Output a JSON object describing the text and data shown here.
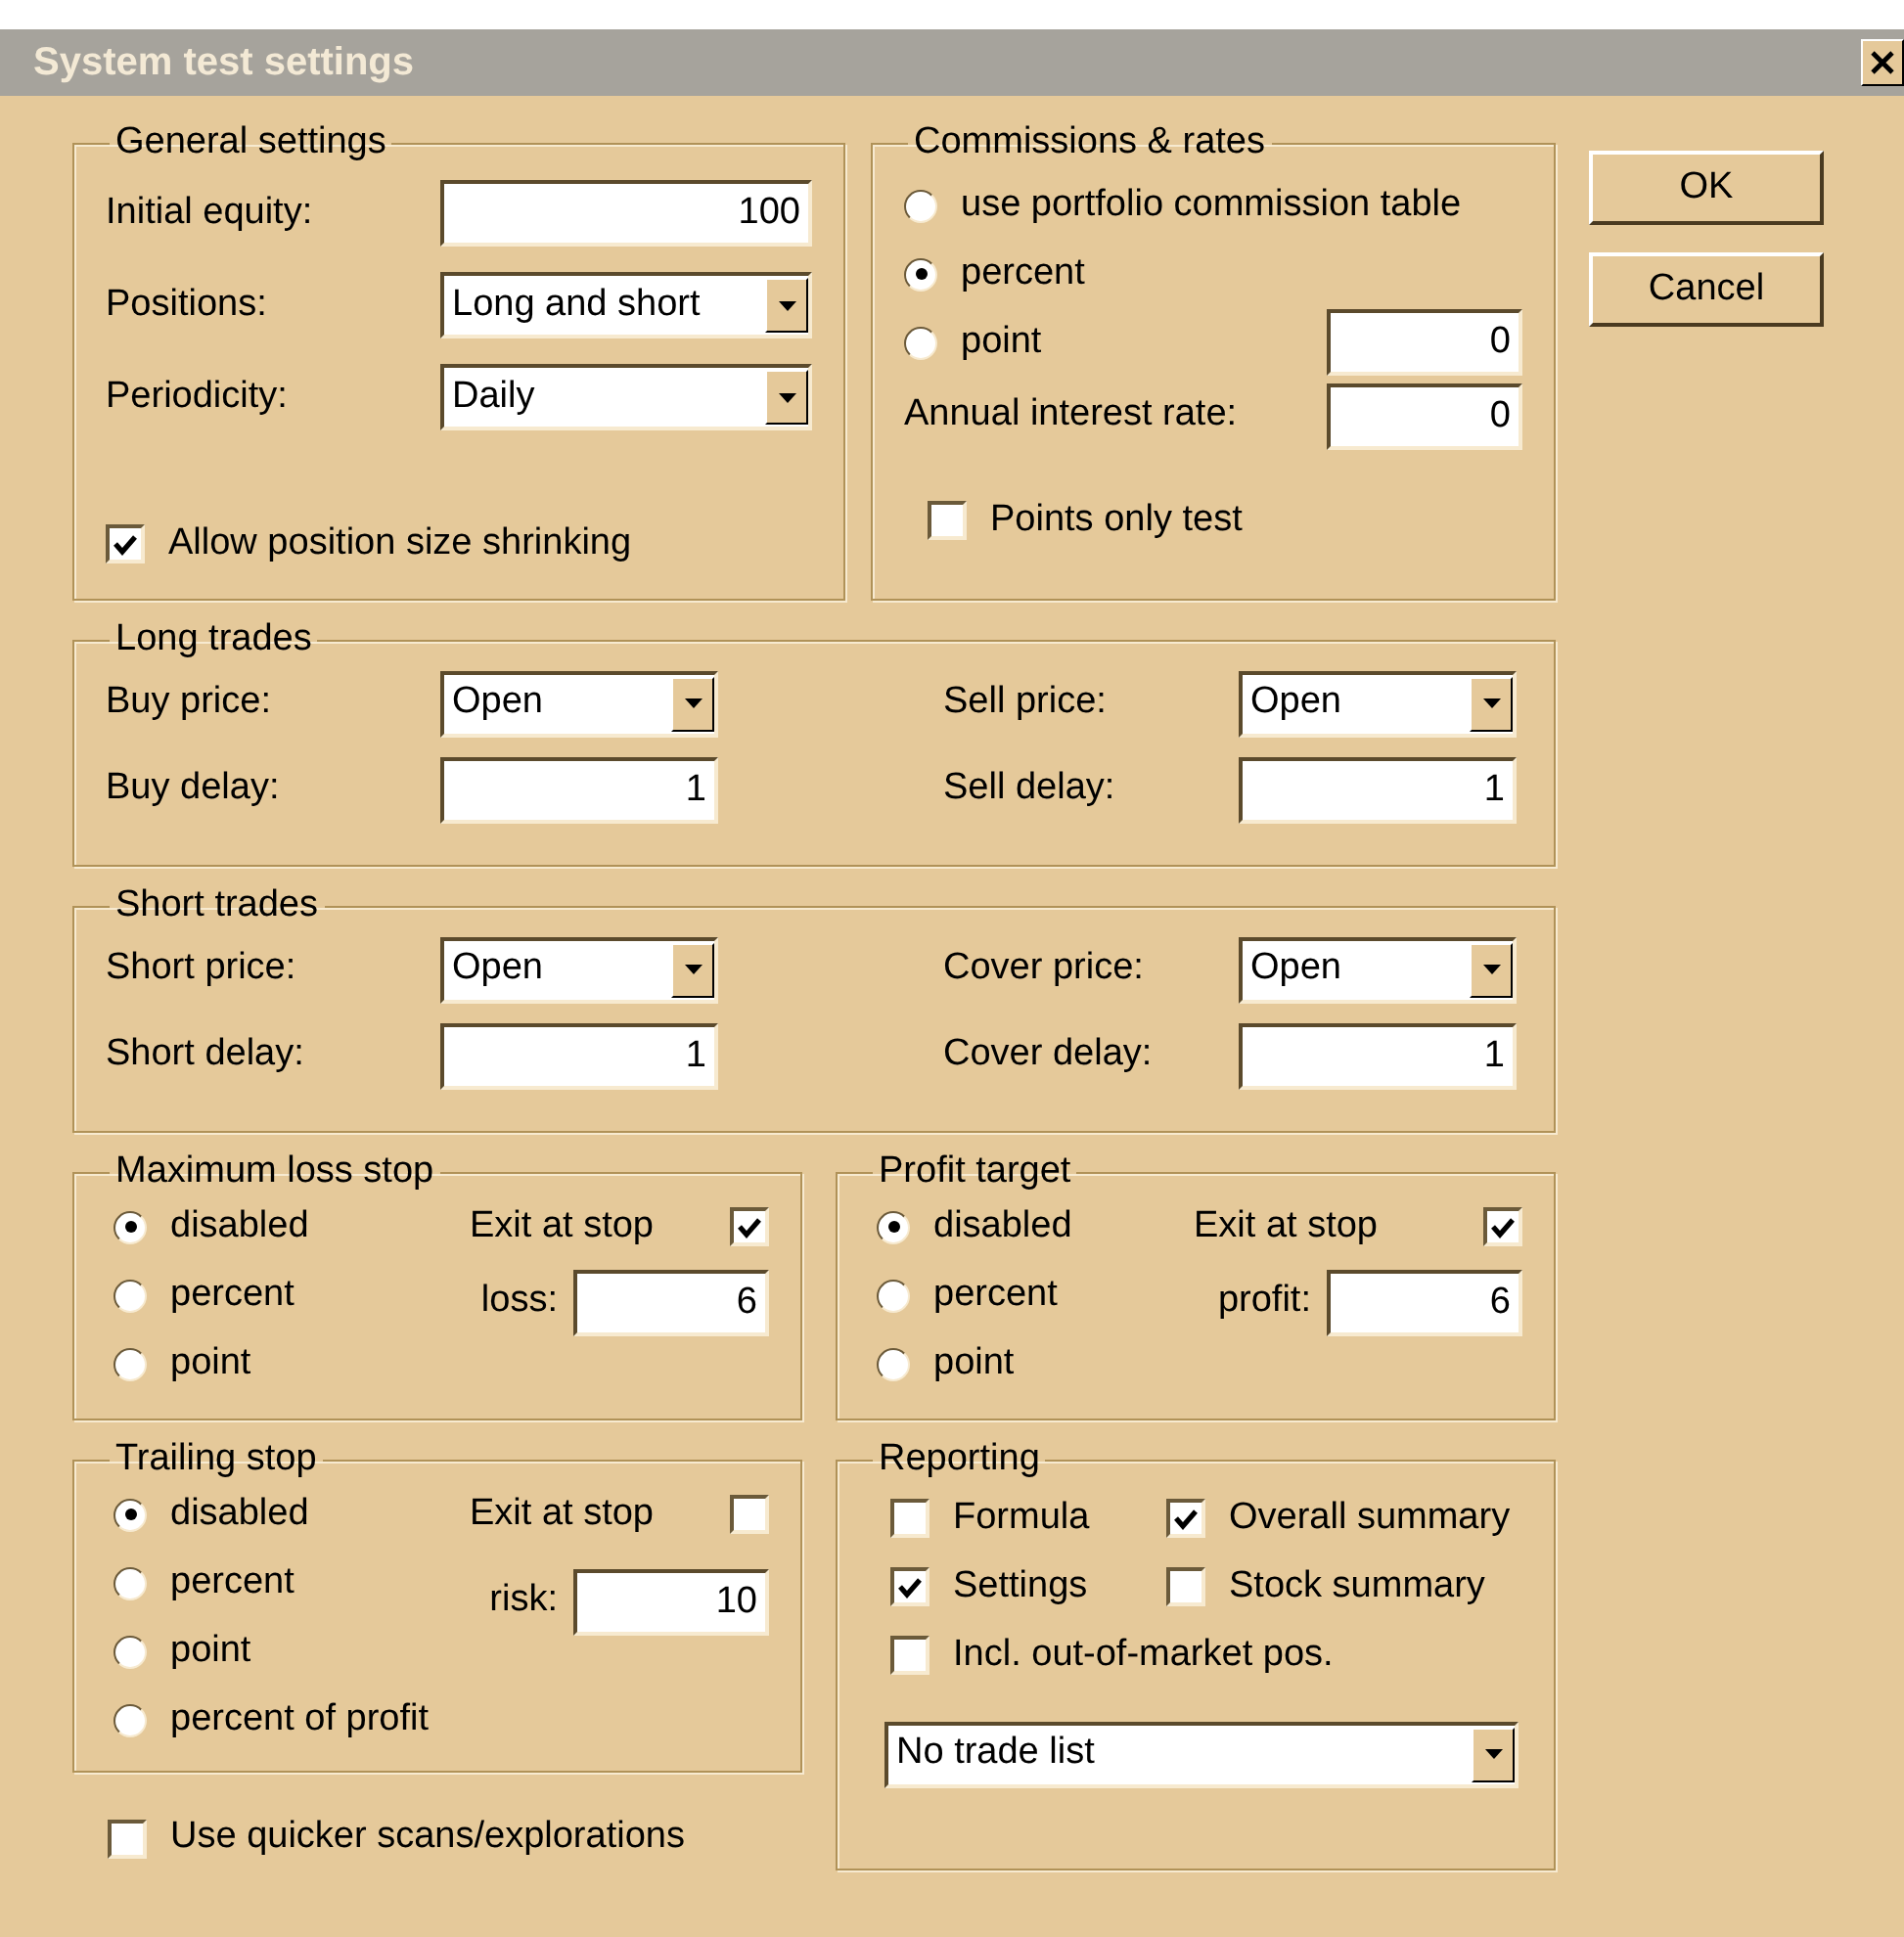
{
  "window": {
    "title": "System test settings"
  },
  "general": {
    "title": "General settings",
    "fields": [
      {
        "kind": "input",
        "label": "Initial equity:",
        "value": "100"
      },
      {
        "kind": "select",
        "label": "Positions:",
        "value": "Long and short"
      },
      {
        "kind": "select",
        "label": "Periodicity:",
        "value": "Daily"
      }
    ],
    "checkbox": {
      "label": "Allow position size shrinking",
      "checked": true
    }
  },
  "commissions": {
    "title": "Commissions & rates",
    "options": [
      {
        "label": "use portfolio commission table",
        "selected": false
      },
      {
        "label": "percent",
        "selected": true
      },
      {
        "label": "point",
        "selected": false
      }
    ],
    "commission_value": "0",
    "interest": {
      "label": "Annual interest rate:",
      "value": "0"
    },
    "points_only": {
      "label": "Points only test",
      "checked": false
    }
  },
  "long_trades": {
    "title": "Long trades",
    "fields": [
      {
        "kind": "select",
        "label": "Buy price:",
        "value": "Open"
      },
      {
        "kind": "select",
        "label": "Sell price:",
        "value": "Open"
      },
      {
        "kind": "input",
        "label": "Buy delay:",
        "value": "1"
      },
      {
        "kind": "input",
        "label": "Sell delay:",
        "value": "1"
      }
    ]
  },
  "short_trades": {
    "title": "Short trades",
    "fields": [
      {
        "kind": "select",
        "label": "Short price:",
        "value": "Open"
      },
      {
        "kind": "select",
        "label": "Cover price:",
        "value": "Open"
      },
      {
        "kind": "input",
        "label": "Short delay:",
        "value": "1"
      },
      {
        "kind": "input",
        "label": "Cover delay:",
        "value": "1"
      }
    ]
  },
  "max_loss_stop": {
    "title": "Maximum loss stop",
    "options": [
      {
        "label": "disabled",
        "selected": true
      },
      {
        "label": "percent",
        "selected": false
      },
      {
        "label": "point",
        "selected": false
      }
    ],
    "exit_at_stop": {
      "label": "Exit at stop",
      "checked": true
    },
    "amount": {
      "label": "loss:",
      "value": "6"
    }
  },
  "profit_target": {
    "title": "Profit target",
    "options": [
      {
        "label": "disabled",
        "selected": true
      },
      {
        "label": "percent",
        "selected": false
      },
      {
        "label": "point",
        "selected": false
      }
    ],
    "exit_at_stop": {
      "label": "Exit at stop",
      "checked": true
    },
    "amount": {
      "label": "profit:",
      "value": "6"
    }
  },
  "trailing_stop": {
    "title": "Trailing stop",
    "options": [
      {
        "label": "disabled",
        "selected": true
      },
      {
        "label": "percent",
        "selected": false
      },
      {
        "label": "point",
        "selected": false
      },
      {
        "label": "percent of profit",
        "selected": false
      }
    ],
    "exit_at_stop": {
      "label": "Exit at stop",
      "checked": false
    },
    "amount": {
      "label": "risk:",
      "value": "10"
    }
  },
  "reporting": {
    "title": "Reporting",
    "checkboxes": [
      {
        "label": "Formula",
        "checked": false
      },
      {
        "label": "Overall summary",
        "checked": true
      },
      {
        "label": "Settings",
        "checked": true
      },
      {
        "label": "Stock summary",
        "checked": false
      },
      {
        "label": "Incl. out-of-market pos.",
        "checked": false
      }
    ],
    "trade_list": {
      "value": "No trade list"
    }
  },
  "quicker_scans": {
    "label": "Use quicker scans/explorations",
    "checked": false
  },
  "buttons": [
    {
      "label": "OK"
    },
    {
      "label": "Cancel"
    }
  ]
}
